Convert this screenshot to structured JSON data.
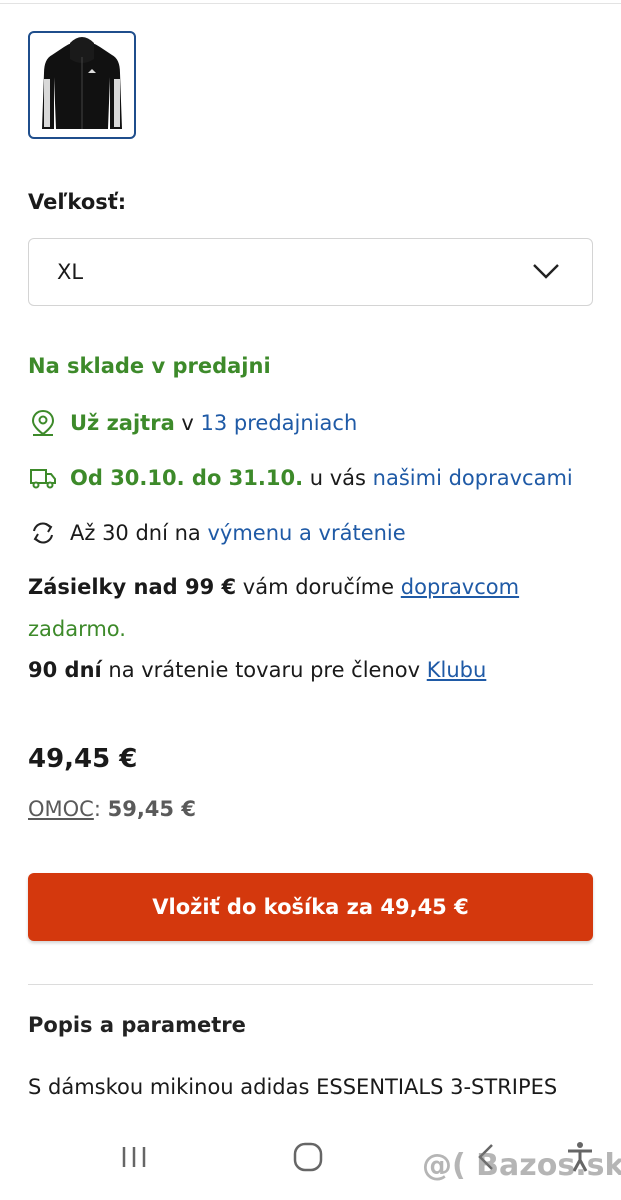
{
  "product": {
    "thumbnail_alt": "hoodie thumbnail"
  },
  "size": {
    "label": "Veľkosť:",
    "selected": "XL"
  },
  "availability": {
    "stock_status": "Na sklade v predajni",
    "pickup": {
      "strong": "Už zajtra",
      "mid": " v ",
      "link": "13 predajniach"
    },
    "delivery": {
      "strong": "Od 30.10. do 31.10.",
      "mid": " u vás ",
      "link": "našimi dopravcami"
    },
    "returns": {
      "prefix": "Až 30 dní na ",
      "link": "výmenu a vrátenie"
    }
  },
  "shipping_note": {
    "strong": "Zásielky nad 99 €",
    "mid": " vám doručíme ",
    "link": "dopravcom",
    "suffix": "zadarmo."
  },
  "club_note": {
    "strong": "90 dní",
    "mid": " na vrátenie tovaru pre členov ",
    "link": "Klubu"
  },
  "pricing": {
    "price": "49,45 €",
    "rrp_label": "OMOC",
    "rrp_sep": ": ",
    "rrp_value": "59,45 €"
  },
  "cart_button_label": "Vložiť do košíka za 49,45 €",
  "description": {
    "title": "Popis a parametre",
    "text": "S dámskou mikinou adidas ESSENTIALS 3-STRIPES"
  },
  "watermark": "@( Bazos.sk",
  "colors": {
    "accent_green": "#3d8a2a",
    "link_blue": "#1f5aa6",
    "cta_orange": "#d4380d",
    "thumb_border": "#1f4e8c"
  }
}
